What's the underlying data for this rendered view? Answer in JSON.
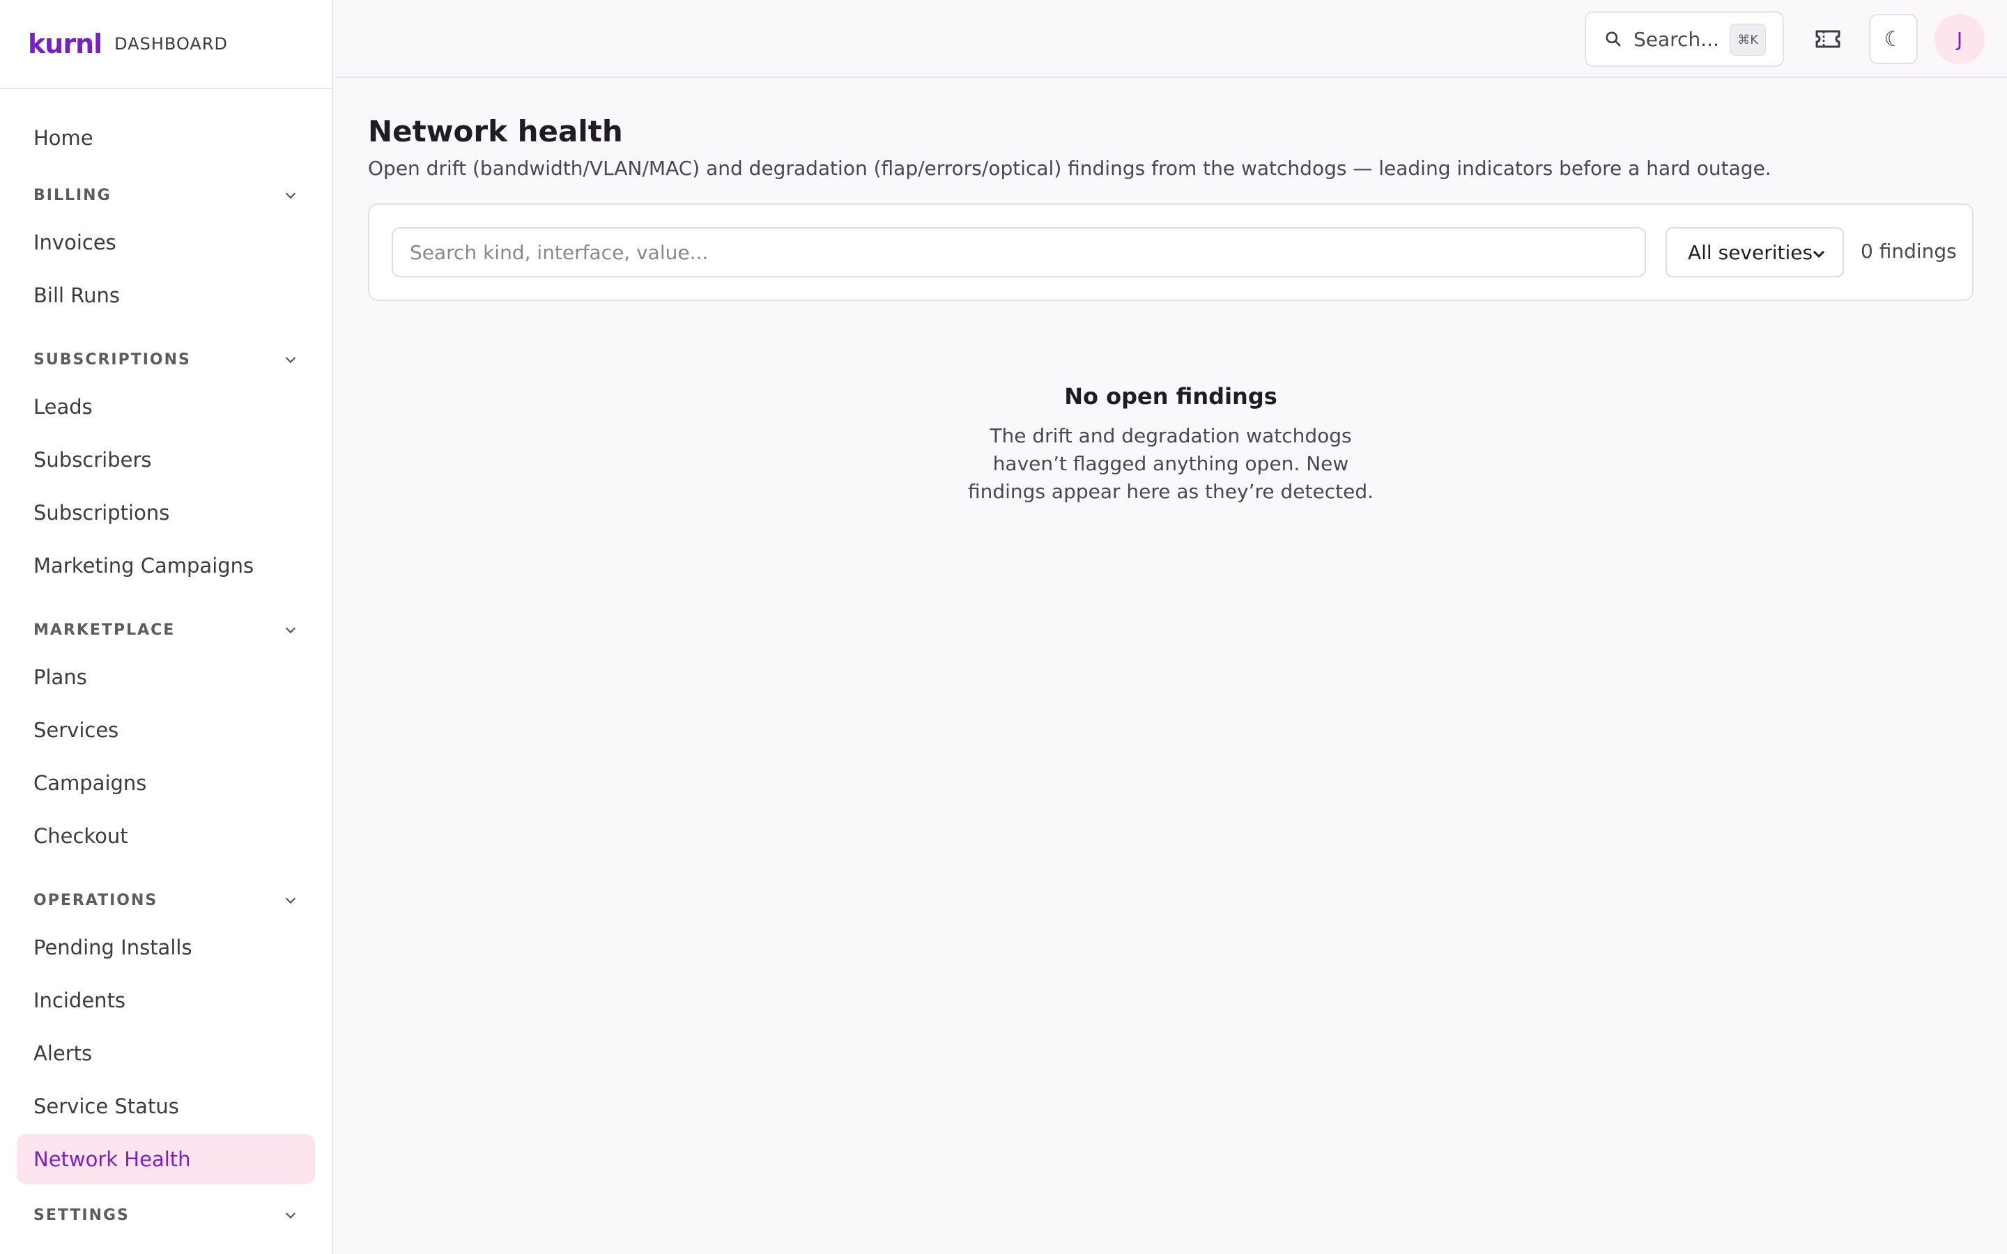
{
  "brand": {
    "name": "kurnl",
    "subtitle": "DASHBOARD"
  },
  "sidebar": {
    "home": "Home",
    "sections": [
      {
        "title": "BILLING",
        "items": [
          "Invoices",
          "Bill Runs"
        ]
      },
      {
        "title": "SUBSCRIPTIONS",
        "items": [
          "Leads",
          "Subscribers",
          "Subscriptions",
          "Marketing Campaigns"
        ]
      },
      {
        "title": "MARKETPLACE",
        "items": [
          "Plans",
          "Services",
          "Campaigns",
          "Checkout"
        ]
      },
      {
        "title": "OPERATIONS",
        "items": [
          "Pending Installs",
          "Incidents",
          "Alerts",
          "Service Status",
          "Network Health"
        ]
      },
      {
        "title": "SETTINGS",
        "items": []
      }
    ],
    "active_item": "Network Health"
  },
  "topbar": {
    "search_label": "Search...",
    "search_shortcut": "⌘K",
    "theme_icon": "moon-icon",
    "avatar_initial": "J"
  },
  "page": {
    "title": "Network health",
    "description": "Open drift (bandwidth/VLAN/MAC) and degradation (flap/errors/optical) findings from the watchdogs — leading indicators before a hard outage.",
    "filter": {
      "placeholder": "Search kind, interface, value...",
      "value": "",
      "severity_selected": "All severities",
      "count_text": "0 findings"
    },
    "empty": {
      "title": "No open findings",
      "body": "The drift and degradation watchdogs haven’t flagged anything open. New findings appear here as they’re detected."
    }
  },
  "colors": {
    "accent": "#7a1fc4",
    "active_bg": "#fde4ef",
    "background": "#faf8fb"
  }
}
